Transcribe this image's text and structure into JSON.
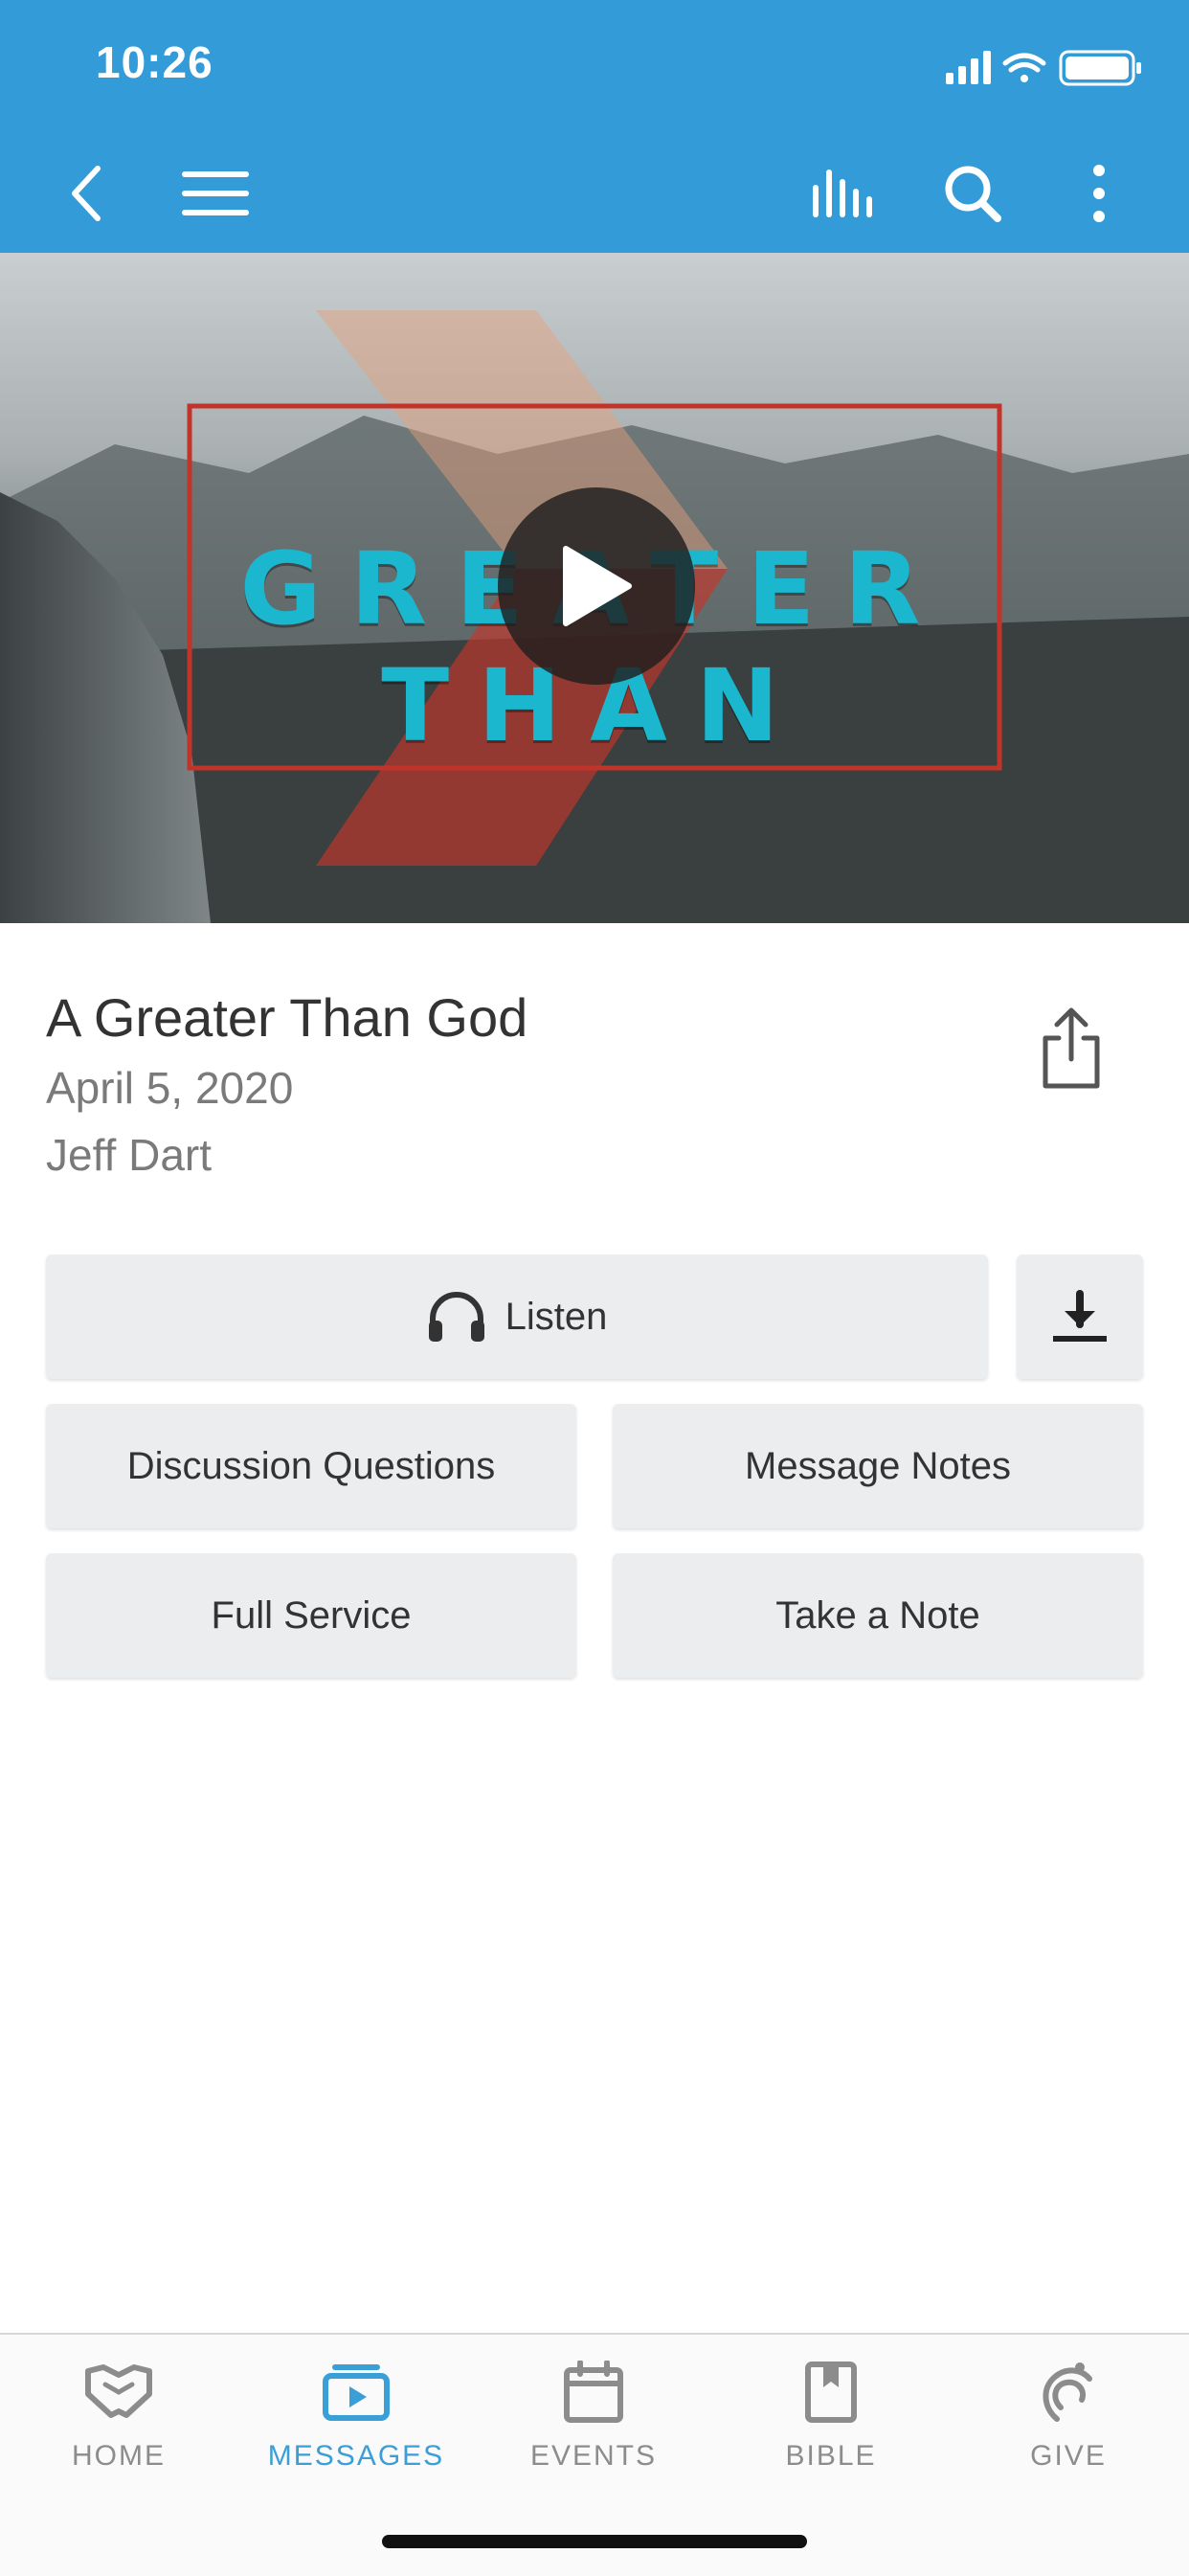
{
  "status_bar": {
    "time": "10:26"
  },
  "nav": {
    "back_icon": "chevron-left-icon",
    "menu_icon": "hamburger-icon",
    "audio_icon": "equalizer-icon",
    "search_icon": "search-icon",
    "more_icon": "vertical-dots-icon"
  },
  "hero": {
    "title": "GREATER THAN",
    "play_icon": "play-icon"
  },
  "message": {
    "title": "A Greater Than God",
    "date": "April 5, 2020",
    "speaker": "Jeff Dart"
  },
  "actions": {
    "listen": "Listen",
    "download_icon": "download-icon",
    "discussion_questions": "Discussion Questions",
    "message_notes": "Message Notes",
    "full_service": "Full Service",
    "take_a_note": "Take a Note"
  },
  "tabs": [
    {
      "label": "HOME",
      "icon": "handshake-icon",
      "active": false
    },
    {
      "label": "MESSAGES",
      "icon": "video-play-icon",
      "active": true
    },
    {
      "label": "EVENTS",
      "icon": "calendar-icon",
      "active": false
    },
    {
      "label": "BIBLE",
      "icon": "book-icon",
      "active": false
    },
    {
      "label": "GIVE",
      "icon": "give-icon",
      "active": false
    }
  ],
  "colors": {
    "brand": "#339cd8",
    "accent": "#1ab7cf",
    "active_tab": "#3a9fd6"
  }
}
